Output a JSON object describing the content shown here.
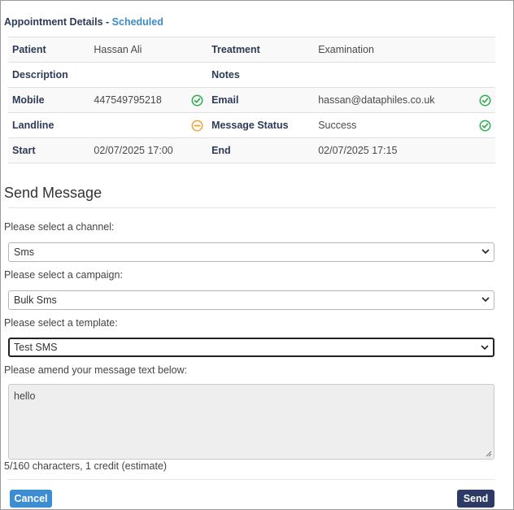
{
  "appointment": {
    "title": "Appointment Details",
    "separator": " - ",
    "status": "Scheduled",
    "rows": [
      {
        "l1": "Patient",
        "v1": "Hassan Ali",
        "i1": "",
        "l2": "Treatment",
        "v2": "Examination",
        "i2": ""
      },
      {
        "l1": "Description",
        "v1": "",
        "i1": "",
        "l2": "Notes",
        "v2": "",
        "i2": ""
      },
      {
        "l1": "Mobile",
        "v1": "447549795218",
        "i1": "check-circle-icon",
        "l2": "Email",
        "v2": "hassan@dataphiles.co.uk",
        "i2": "check-circle-icon"
      },
      {
        "l1": "Landline",
        "v1": "",
        "i1": "minus-circle-icon",
        "l2": "Message Status",
        "v2": "Success",
        "i2": "check-circle-icon"
      },
      {
        "l1": "Start",
        "v1": "02/07/2025 17:00",
        "i1": "",
        "l2": "End",
        "v2": "02/07/2025 17:15",
        "i2": ""
      }
    ]
  },
  "send_message": {
    "title": "Send Message",
    "channel_label": "Please select a channel:",
    "channel_value": "Sms",
    "campaign_label": "Please select a campaign:",
    "campaign_value": "Bulk Sms",
    "template_label": "Please select a template:",
    "template_value": "Test SMS",
    "message_label": "Please amend your message text below:",
    "message_value": "hello",
    "char_count": "5/160 characters, 1 credit (estimate)"
  },
  "buttons": {
    "cancel": "Cancel",
    "send": "Send"
  },
  "colors": {
    "ok": "#2eaa4a",
    "warn": "#f0a030",
    "status": "#3d8bc6",
    "label": "#2e3b56"
  }
}
